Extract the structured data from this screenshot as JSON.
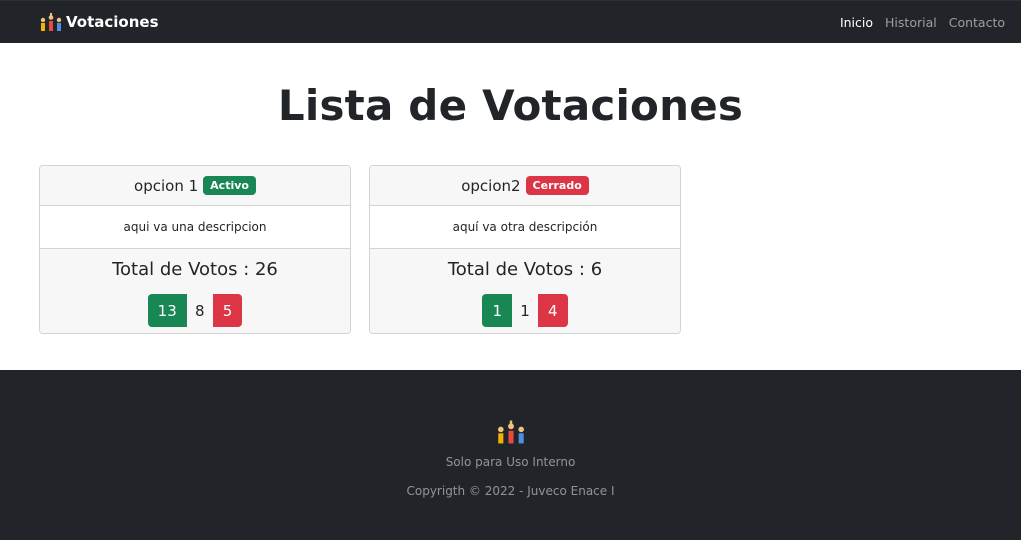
{
  "navbar": {
    "brand": "Votaciones",
    "links": [
      "Inicio",
      "Historial",
      "Contacto"
    ]
  },
  "main": {
    "title": "Lista de Votaciones",
    "cards": [
      {
        "name": "opcion 1",
        "status": "Activo",
        "description": "aqui va una descripcion",
        "total": "Total de Votos : 26",
        "counts": [
          "13",
          "8",
          "5"
        ]
      },
      {
        "name": "opcion2",
        "status": "Cerrado",
        "description": "aquí va otra descripción",
        "total": "Total de Votos : 6",
        "counts": [
          "1",
          "1",
          "4"
        ]
      }
    ]
  },
  "footer": {
    "internal": "Solo para Uso Interno",
    "copyright": "Copyrigth © 2022 - Juveco Enace I"
  },
  "colors": {
    "navbar": "#212529",
    "active_badge": "#198754",
    "closed_badge": "#dc3545",
    "positive_count": "#198754",
    "negative_count": "#dc3545"
  },
  "icons": {
    "brand": "raised-hands-logo-icon",
    "footer": "raised-hands-logo-icon"
  }
}
